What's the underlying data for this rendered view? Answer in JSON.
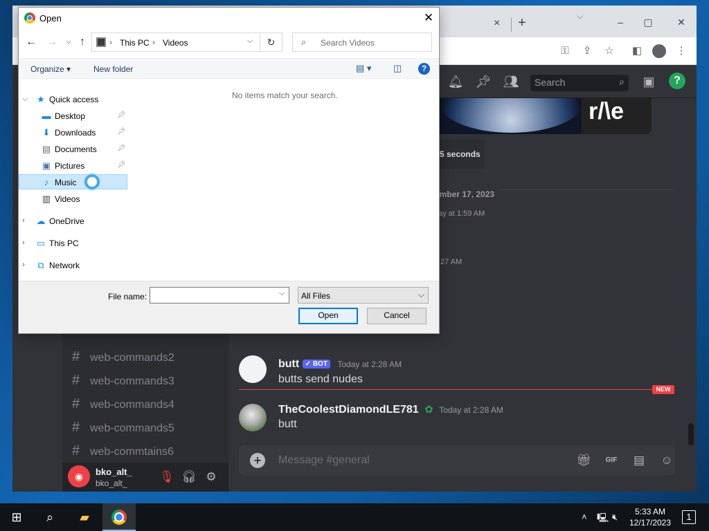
{
  "browser": {
    "tab_close": "×",
    "new_tab": "+",
    "min": "–",
    "max": "▢",
    "close": "✕"
  },
  "discord": {
    "search_placeholder": "Search",
    "embed_logo": "r/\\e",
    "reply_fragment": "5 seconds",
    "date_fragment": "ember 17, 2023",
    "ts_fragment_1": "ay at 1:59 AM",
    "ts_fragment_2": ":27 AM",
    "channels": [
      "web-commands2",
      "web-commands3",
      "web-commands4",
      "web-commands5",
      "web-commtains6"
    ],
    "user": {
      "name": "bko_alt_",
      "tag": "bko_alt_"
    },
    "messages": [
      {
        "author": "butt",
        "badge": "✓ BOT",
        "time": "Today at 2:28 AM",
        "text": "butts send nudes"
      },
      {
        "author": "TheCoolestDiamondLE781",
        "time": "Today at 2:28 AM",
        "text": "butt"
      }
    ],
    "new_badge": "NEW",
    "composer_placeholder": "Message #general",
    "gif_label": "GIF"
  },
  "dialog": {
    "title": "Open",
    "breadcrumb": [
      "This PC",
      "Videos"
    ],
    "search_placeholder": "Search Videos",
    "organize": "Organize ▾",
    "new_folder": "New folder",
    "empty_message": "No items match your search.",
    "nav": {
      "quick_access": "Quick access",
      "desktop": "Desktop",
      "downloads": "Downloads",
      "documents": "Documents",
      "pictures": "Pictures",
      "music": "Music",
      "videos": "Videos",
      "onedrive": "OneDrive",
      "thispc": "This PC",
      "network": "Network"
    },
    "file_name_label": "File name:",
    "file_name_value": "",
    "file_type": "All Files",
    "open_button": "Open",
    "cancel_button": "Cancel"
  },
  "taskbar": {
    "time": "5:33 AM",
    "date": "12/17/2023",
    "notification_count": "1"
  },
  "colors": {
    "discord_bg": "#313338",
    "discord_accent": "#5865f2",
    "new_red": "#f23f43",
    "selection": "#cce8ff",
    "win_blue": "#0078d7"
  }
}
